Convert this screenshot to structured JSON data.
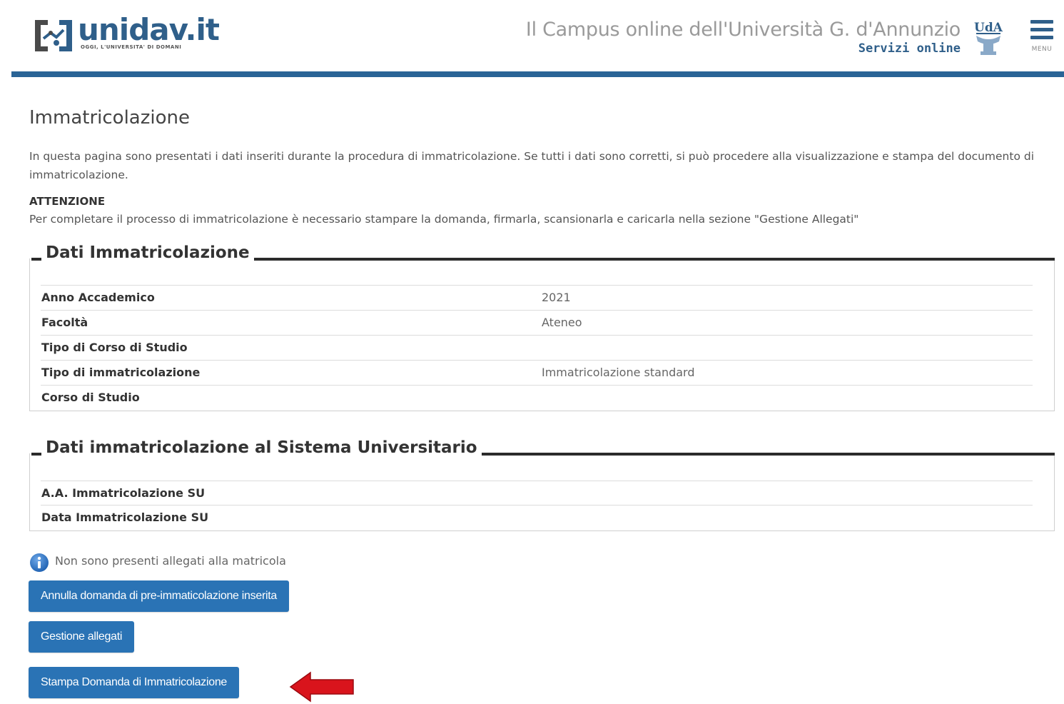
{
  "header": {
    "logo_text": "unidav.it",
    "logo_tagline": "OGGI, L'UNIVERSITA' DI DOMANI",
    "campus_title": "Il Campus online dell'Università G. d'Annunzio",
    "campus_subtitle": "Servizi online",
    "uda_logo_text": "UdA",
    "menu_label": "MENU"
  },
  "main": {
    "title": "Immatricolazione",
    "intro": "In questa pagina sono presentati i dati inseriti durante la procedura di immatricolazione. Se tutti i dati sono corretti, si può procedere alla visualizzazione e stampa del documento di immatricolazione.",
    "attention_heading": "ATTENZIONE",
    "attention_text": "Per completare il processo di immatricolazione è necessario stampare la domanda, firmarla, scansionarla e caricarla nella sezione \"Gestione Allegati\""
  },
  "dati_immatricolazione": {
    "legend": "Dati Immatricolazione",
    "rows": [
      {
        "label": "Anno Accademico",
        "value": "2021"
      },
      {
        "label": "Facoltà",
        "value": "Ateneo"
      },
      {
        "label": "Tipo di Corso di Studio",
        "value": ""
      },
      {
        "label": "Tipo di immatricolazione",
        "value": "Immatricolazione standard"
      },
      {
        "label": "Corso di Studio",
        "value": ""
      }
    ]
  },
  "dati_su": {
    "legend": "Dati immatricolazione al Sistema Universitario",
    "rows": [
      {
        "label": "A.A. Immatricolazione SU",
        "value": ""
      },
      {
        "label": "Data Immatricolazione SU",
        "value": ""
      }
    ]
  },
  "notice": {
    "icon": "info-icon",
    "text": "Non sono presenti allegati alla matricola"
  },
  "buttons": {
    "annulla": "Annulla domanda di pre-immaticolazione inserita",
    "gestione": "Gestione allegati",
    "stampa": "Stampa Domanda di Immatricolazione"
  },
  "colors": {
    "brand_blue": "#2a6496",
    "button_blue": "#2a73b5",
    "arrow_red": "#d9141c"
  }
}
